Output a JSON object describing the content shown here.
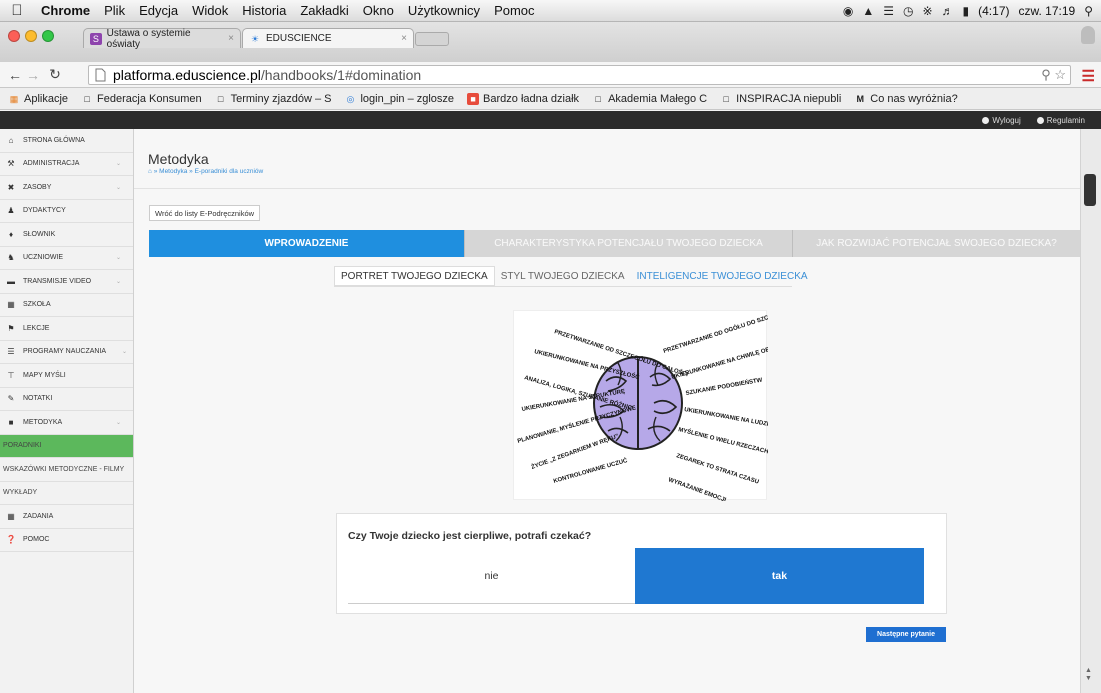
{
  "menubar": {
    "app": "Chrome",
    "items": [
      "Plik",
      "Edycja",
      "Widok",
      "Historia",
      "Zakładki",
      "Okno",
      "Użytkownicy",
      "Pomoc"
    ],
    "battery": "(4:17)",
    "clock": "czw. 17:19"
  },
  "tabs": [
    {
      "title": "Ustawa o systemie oświaty",
      "active": false
    },
    {
      "title": "EDUSCIENCE",
      "active": true
    }
  ],
  "address": {
    "host": "platforma.eduscience.pl",
    "path": "/handbooks/1#domination"
  },
  "bookmarks": [
    {
      "label": "Aplikacje",
      "icon": "apps-grid-icon"
    },
    {
      "label": "Federacja Konsumen",
      "icon": "page-icon"
    },
    {
      "label": "Terminy zjazdów – S",
      "icon": "page-icon"
    },
    {
      "label": "login_pin – zglosze",
      "icon": "globe-icon"
    },
    {
      "label": "Bardzo ładna działk",
      "icon": "red-app-icon"
    },
    {
      "label": "Akademia Małego C",
      "icon": "page-icon"
    },
    {
      "label": "INSPIRACJA niepubli",
      "icon": "page-icon"
    },
    {
      "label": "Co nas wyróżnia?",
      "icon": "m-logo-icon"
    }
  ],
  "site_topbar": {
    "logout": "Wyloguj",
    "regulations": "Regulamin"
  },
  "sidebar": {
    "items": [
      {
        "label": "STRONA GŁÓWNA",
        "icon": "home-icon",
        "has_chevron": false
      },
      {
        "label": "ADMINISTRACJA",
        "icon": "wrench-icon",
        "has_chevron": true
      },
      {
        "label": "ZASOBY",
        "icon": "tools-icon",
        "has_chevron": true
      },
      {
        "label": "DYDAKTYCY",
        "icon": "users-icon",
        "has_chevron": false
      },
      {
        "label": "SŁOWNIK",
        "icon": "book-icon",
        "has_chevron": false
      },
      {
        "label": "UCZNIOWIE",
        "icon": "students-icon",
        "has_chevron": true
      },
      {
        "label": "TRANSMISJE VIDEO",
        "icon": "video-icon",
        "has_chevron": true
      },
      {
        "label": "SZKOŁA",
        "icon": "building-icon",
        "has_chevron": false
      },
      {
        "label": "LEKCJE",
        "icon": "lessons-icon",
        "has_chevron": false
      },
      {
        "label": "PROGRAMY NAUCZANIA",
        "icon": "list-icon",
        "has_chevron": true
      },
      {
        "label": "MAPY MYŚLI",
        "icon": "mindmap-icon",
        "has_chevron": false
      },
      {
        "label": "NOTATKI",
        "icon": "pencil-icon",
        "has_chevron": false
      },
      {
        "label": "METODYKA",
        "icon": "methodology-icon",
        "has_chevron": true
      }
    ],
    "sub_items": [
      {
        "label": "PORADNIKI",
        "active": true
      },
      {
        "label": "WSKAZÓWKI METODYCZNE - FILMY",
        "active": false
      },
      {
        "label": "WYKŁADY",
        "active": false
      }
    ],
    "bottom_items": [
      {
        "label": "ZADANIA",
        "icon": "calendar-icon"
      },
      {
        "label": "POMOC",
        "icon": "help-icon"
      }
    ]
  },
  "page": {
    "title": "Metodyka",
    "breadcrumb": "» Metodyka » E-poradniki dla uczniów",
    "back_button": "Wróć do listy E-Podręczników"
  },
  "main_tabs": [
    {
      "label": "WPROWADZENIE",
      "active": true
    },
    {
      "label": "CHARAKTERYSTYKA POTENCJAŁU TWOJEGO DZIECKA",
      "active": false
    },
    {
      "label": "JAK ROZWIJAĆ POTENCJAŁ SWOJEGO DZIECKA?",
      "active": false
    }
  ],
  "sub_tabs": [
    {
      "label": "PORTRET TWOJEGO DZIECKA",
      "state": "active"
    },
    {
      "label": "STYL TWOJEGO DZIECKA",
      "state": "normal"
    },
    {
      "label": "INTELIGENCJE TWOJEGO DZIECKA",
      "state": "link"
    }
  ],
  "brain_labels": {
    "left": [
      "PRZETWARZANIE OD SZCZEGÓŁU DO CAŁOŚCI",
      "UKIERUNKOWANIE NA PRZYSZŁOŚĆ",
      "ANALIZA, LOGIKA, SZUKANIE RÓŻNIC",
      "UKIERUNKOWANIE NA STRUKTURĘ",
      "PLANOWANIE, MYŚLENIE PRZYCZYNOWE",
      "ŻYCIE „Z ZEGARKIEM W RĘKU”",
      "KONTROLOWANIE UCZUĆ"
    ],
    "right": [
      "PRZETWARZANIE OD OGÓŁU DO SZCZEGÓŁU",
      "UKIERUNKOWANIE NA CHWILĘ OBECNĄ",
      "SZUKANIE PODOBIEŃSTW",
      "UKIERUNKOWANIE NA LUDZI",
      "MYŚLENIE O WIELU RZECZACH NA RAZ",
      "ZEGAREK TO STRATA CZASU",
      "WYRAŻANIE EMOCJI"
    ]
  },
  "question": {
    "text": "Czy Twoje dziecko jest cierpliwe, potrafi czekać?",
    "answer_no": "nie",
    "answer_yes": "tak"
  },
  "next_button": "Następne pytanie",
  "colors": {
    "primary_blue": "#1f8fdf",
    "answer_blue": "#1f78d1",
    "sidebar_active_green": "#5cb85c",
    "topbar_dark": "#2b2b2b"
  }
}
